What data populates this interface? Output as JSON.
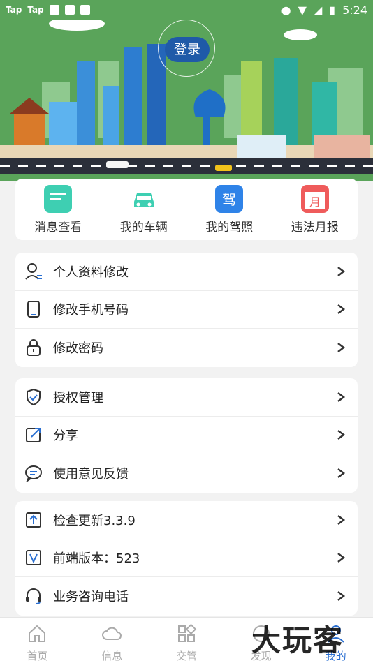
{
  "status_bar": {
    "apps": [
      "Tap",
      "Tap"
    ],
    "time": "5:24"
  },
  "header": {
    "login_label": "登录"
  },
  "quick_actions": [
    {
      "label": "消息查看",
      "icon": "message-icon",
      "color": "#3ecfb2"
    },
    {
      "label": "我的车辆",
      "icon": "car-icon",
      "color": "#3ecfb2"
    },
    {
      "label": "我的驾照",
      "icon": "license-icon",
      "color": "#2f83e8"
    },
    {
      "label": "违法月报",
      "icon": "calendar-icon",
      "color": "#ef5b5b"
    }
  ],
  "groups": [
    {
      "items": [
        {
          "label": "个人资料修改",
          "icon": "profile-icon"
        },
        {
          "label": "修改手机号码",
          "icon": "phone-icon"
        },
        {
          "label": "修改密码",
          "icon": "lock-icon"
        }
      ]
    },
    {
      "items": [
        {
          "label": "授权管理",
          "icon": "shield-icon"
        },
        {
          "label": "分享",
          "icon": "share-icon"
        },
        {
          "label": "使用意见反馈",
          "icon": "feedback-icon"
        }
      ]
    },
    {
      "items": [
        {
          "label": "检查更新3.3.9",
          "icon": "update-icon"
        },
        {
          "label": "前端版本：523",
          "icon": "version-icon"
        },
        {
          "label": "业务咨询电话",
          "icon": "headset-icon"
        }
      ]
    }
  ],
  "bottom_nav": [
    {
      "label": "首页",
      "icon": "home-icon",
      "active": false
    },
    {
      "label": "信息",
      "icon": "cloud-icon",
      "active": false
    },
    {
      "label": "交管",
      "icon": "grid-icon",
      "active": false
    },
    {
      "label": "发现",
      "icon": "discover-icon",
      "active": false
    },
    {
      "label": "我的",
      "icon": "user-icon",
      "active": true
    }
  ],
  "watermark": "大玩客",
  "colors": {
    "header_green": "#5aa45a",
    "primary_blue": "#1f5aa8",
    "active_nav": "#2a6fd1"
  }
}
